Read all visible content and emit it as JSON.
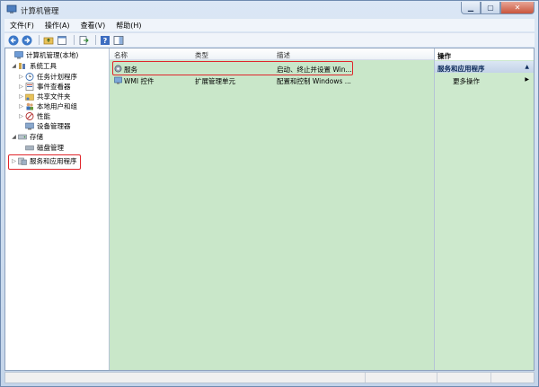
{
  "window": {
    "title": "计算机管理",
    "colors": {
      "frame": "#c4d5ea",
      "list_bg": "#c9e7c9",
      "highlight": "#e0262b",
      "close": "#c9553c"
    }
  },
  "menu": [
    {
      "label": "文件(F)"
    },
    {
      "label": "操作(A)"
    },
    {
      "label": "查看(V)"
    },
    {
      "label": "帮助(H)"
    }
  ],
  "toolbar": {
    "icons": [
      "back-arrow-icon",
      "forward-arrow-icon",
      "folder-up-icon",
      "properties-icon",
      "export-icon",
      "help-icon",
      "show-hide-pane-icon"
    ]
  },
  "tree": {
    "items": [
      {
        "label": "计算机管理(本地)",
        "icon": "computer-icon",
        "toggle": ""
      },
      {
        "label": "系统工具",
        "icon": "tools-icon",
        "toggle": "◢"
      },
      {
        "label": "任务计划程序",
        "icon": "clock-icon",
        "toggle": "▷"
      },
      {
        "label": "事件查看器",
        "icon": "event-icon",
        "toggle": "▷"
      },
      {
        "label": "共享文件夹",
        "icon": "shared-folder-icon",
        "toggle": "▷"
      },
      {
        "label": "本地用户和组",
        "icon": "users-icon",
        "toggle": "▷"
      },
      {
        "label": "性能",
        "icon": "performance-icon",
        "toggle": "▷"
      },
      {
        "label": "设备管理器",
        "icon": "device-icon",
        "toggle": ""
      },
      {
        "label": "存储",
        "icon": "storage-icon",
        "toggle": "◢"
      },
      {
        "label": "磁盘管理",
        "icon": "disk-icon",
        "toggle": ""
      },
      {
        "label": "服务和应用程序",
        "icon": "services-apps-icon",
        "toggle": "▷"
      }
    ]
  },
  "list": {
    "columns": [
      "名称",
      "类型",
      "描述"
    ],
    "rows": [
      {
        "name": "服务",
        "type": "",
        "desc": "启动、终止并设置 Win..."
      },
      {
        "name": "WMI 控件",
        "type": "扩展管理单元",
        "desc": "配置和控制 Windows ..."
      }
    ]
  },
  "actions": {
    "header": "操作",
    "section": "服务和应用程序",
    "more": "更多操作",
    "section_arrow": "▲",
    "more_arrow": "▶"
  }
}
